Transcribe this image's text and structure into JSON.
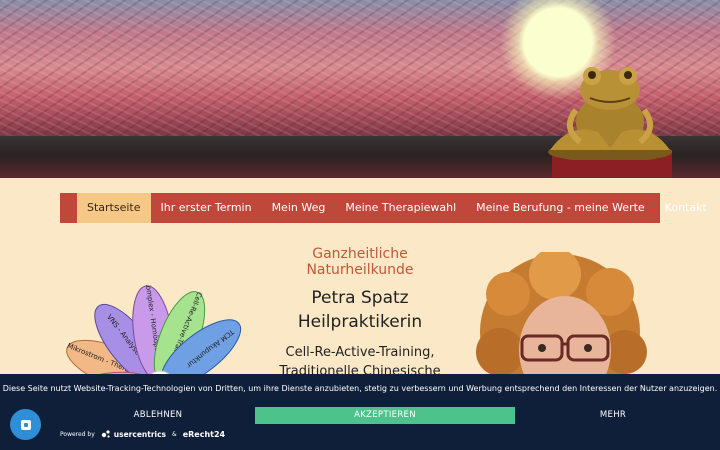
{
  "nav": {
    "items": [
      {
        "label": "Startseite",
        "active": true
      },
      {
        "label": "Ihr erster Termin"
      },
      {
        "label": "Mein Weg"
      },
      {
        "label": "Meine Therapiewahl"
      },
      {
        "label": "Meine Berufung - meine Werte"
      },
      {
        "label": "Kontakt"
      }
    ]
  },
  "content": {
    "subtitle": "Ganzheitliche Naturheilkunde",
    "name_line1": "Petra Spatz",
    "name_line2": "Heilpraktikerin",
    "services_line1": "Cell-Re-Active-Training,",
    "services_line2": "Traditionelle Chinesische"
  },
  "flower_petals": [
    {
      "label": "VNS - Analyse",
      "color": "#a78fe6"
    },
    {
      "label": "Komplex - Homöopathie",
      "color": "#c89ae9"
    },
    {
      "label": "Cell-Re-Active-Training",
      "color": "#a6e38f"
    },
    {
      "label": "TCM Akupunktur",
      "color": "#6fa0e3"
    },
    {
      "label": "Mikrostrom - Therapie",
      "color": "#f2b885"
    },
    {
      "label": "",
      "color": "#f2a0b8"
    }
  ],
  "cookie": {
    "text": "Diese Seite nutzt Website-Tracking-Technologien von Dritten, um ihre Dienste anzubieten, stetig zu verbessern und Werbung entsprechend den Interessen der Nutzer anzuzeigen.",
    "decline_label": "ABLEHNEN",
    "accept_label": "AKZEPTIEREN",
    "more_label": "MEHR",
    "powered_by": "Powered by",
    "brand1": "usercentrics",
    "amp": "&",
    "brand2": "eRecht24"
  },
  "colors": {
    "nav_bg": "#c0483a",
    "nav_active": "#f6c886",
    "page_bg": "#fbe8c6",
    "banner_bg": "#0f1f3a",
    "accept_bg": "#4ec28b",
    "accent_text": "#c0583a"
  },
  "icons": {
    "fab": "privacy-settings-icon",
    "logo": "usercentrics-logo-icon"
  }
}
